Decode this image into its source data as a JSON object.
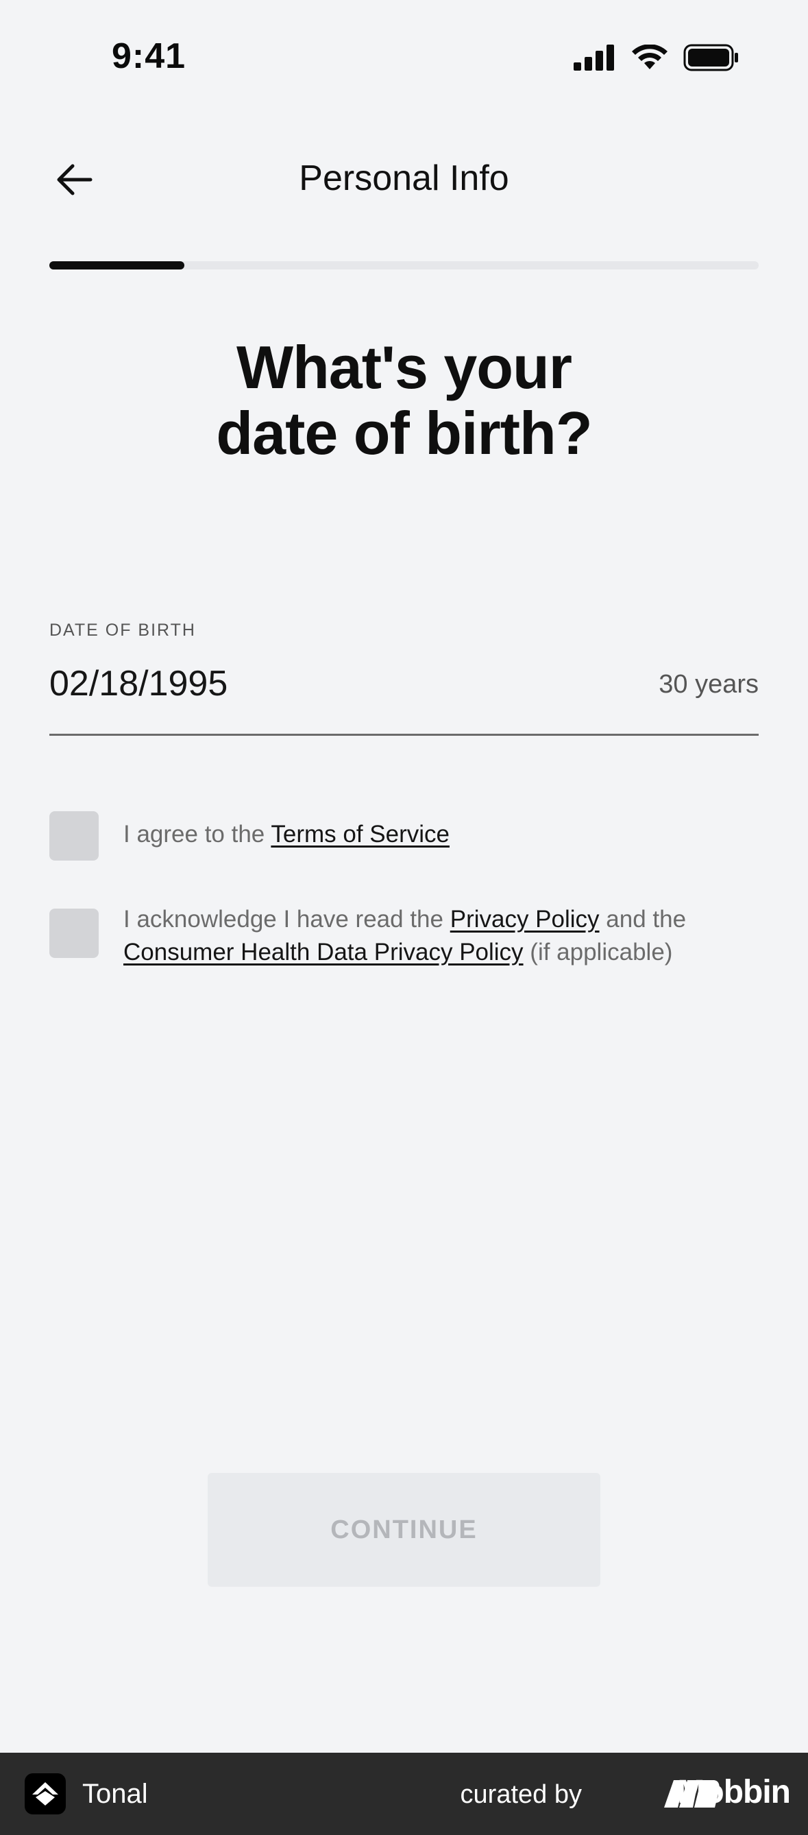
{
  "status_bar": {
    "time": "9:41"
  },
  "header": {
    "title": "Personal Info",
    "back_icon": "arrow-left-icon"
  },
  "progress": {
    "fraction": 0.19
  },
  "question": {
    "line1": "What's your",
    "line2": "date of birth?"
  },
  "dob": {
    "label": "DATE OF BIRTH",
    "value": "02/18/1995",
    "age": "30 years"
  },
  "consents": {
    "terms": {
      "prefix": "I agree to the ",
      "link": "Terms of Service",
      "checked": false
    },
    "privacy": {
      "prefix": "I acknowledge I have read the ",
      "link1": "Privacy Policy",
      "middle": " and the ",
      "link2": "Consumer Health Data Privacy Policy",
      "suffix": " (if applicable)",
      "checked": false
    }
  },
  "continue_button": {
    "label": "CONTINUE",
    "enabled": false
  },
  "footer": {
    "app_name": "Tonal",
    "curated_by": "curated by",
    "brand": "Mobbin"
  },
  "colors": {
    "background": "#f3f4f6",
    "progress_fill": "#0d0d0d",
    "checkbox": "#d3d4d7",
    "button_disabled_bg": "#e8eaed",
    "footer_bg": "#2b2b2b"
  }
}
